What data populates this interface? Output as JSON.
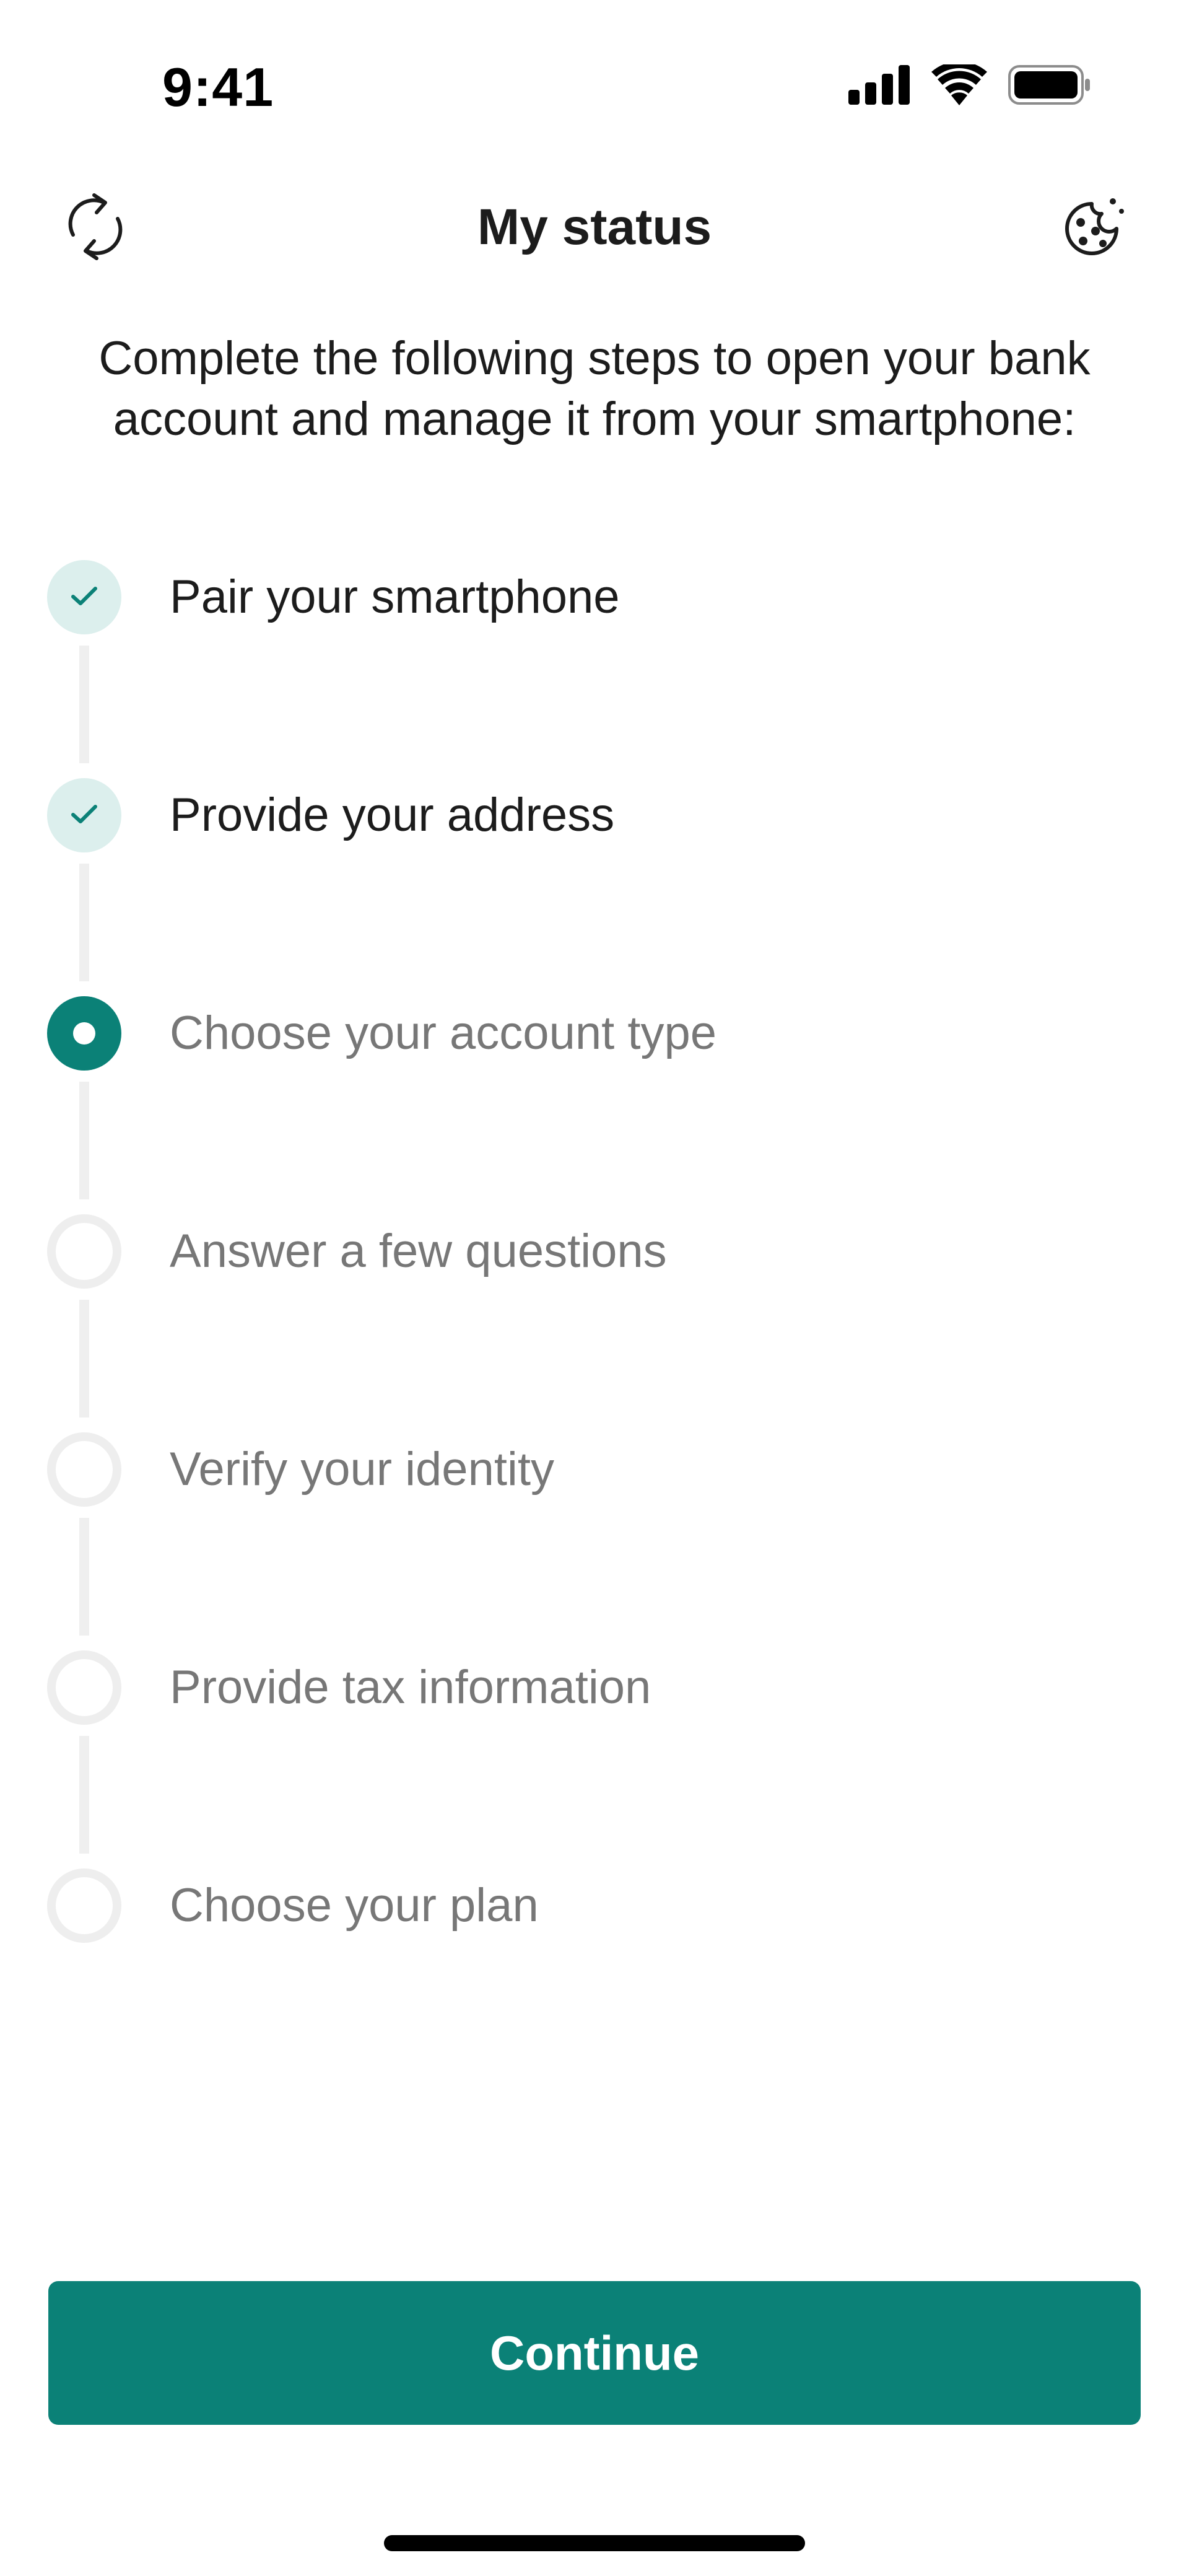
{
  "status_bar": {
    "time": "9:41"
  },
  "header": {
    "title": "My status",
    "refresh_icon": "refresh-icon",
    "cookie_icon": "cookie-icon"
  },
  "intro": {
    "text": "Complete the following steps to open your bank account and manage it from your smartphone:"
  },
  "steps": [
    {
      "label": "Pair your smartphone",
      "state": "done"
    },
    {
      "label": "Provide your address",
      "state": "done"
    },
    {
      "label": "Choose your account type",
      "state": "current"
    },
    {
      "label": "Answer a few questions",
      "state": "todo"
    },
    {
      "label": "Verify your identity",
      "state": "todo"
    },
    {
      "label": "Provide tax information",
      "state": "todo"
    },
    {
      "label": "Choose your plan",
      "state": "todo"
    }
  ],
  "actions": {
    "continue_label": "Continue"
  },
  "colors": {
    "accent": "#0b8177",
    "done_bg": "#dcefed",
    "pending_ring": "#eeeeee",
    "text_dark": "#1c1c1c",
    "text_muted": "#777777"
  }
}
